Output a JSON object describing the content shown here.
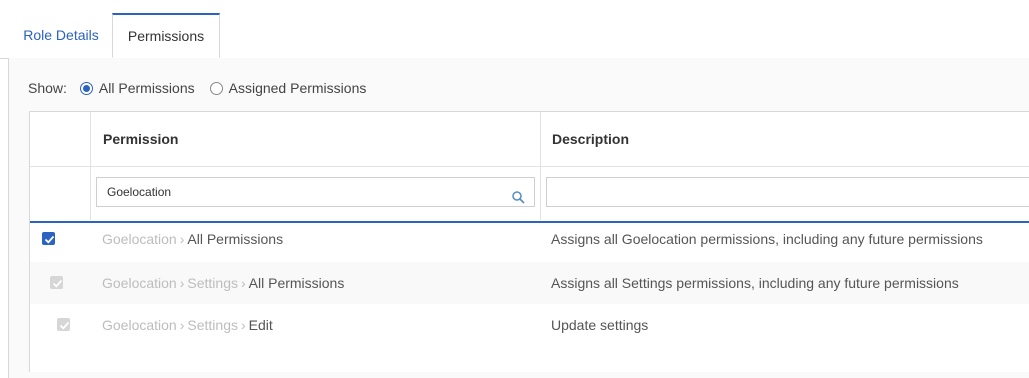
{
  "tabs": [
    {
      "label": "Role Details"
    },
    {
      "label": "Permissions"
    }
  ],
  "show": {
    "label": "Show:",
    "options": [
      {
        "label": "All Permissions",
        "selected": true
      },
      {
        "label": "Assigned Permissions",
        "selected": false
      }
    ]
  },
  "table": {
    "columns": [
      "Permission",
      "Description"
    ],
    "filters": {
      "permission": "Goelocation",
      "description": ""
    },
    "rows": [
      {
        "checked": true,
        "disabled": false,
        "path": [
          "Goelocation"
        ],
        "name": "All Permissions",
        "description": "Assigns all Goelocation permissions, including any future permissions"
      },
      {
        "checked": true,
        "disabled": true,
        "path": [
          "Goelocation",
          "Settings"
        ],
        "name": "All Permissions",
        "description": "Assigns all Settings permissions, including any future permissions"
      },
      {
        "checked": true,
        "disabled": true,
        "path": [
          "Goelocation",
          "Settings"
        ],
        "name": "Edit",
        "description": "Update settings"
      }
    ]
  },
  "colors": {
    "accent": "#2a63c0",
    "disabled_check": "#d6d6d6"
  },
  "icons": {
    "search": "search-icon",
    "check": "checkmark-icon"
  }
}
